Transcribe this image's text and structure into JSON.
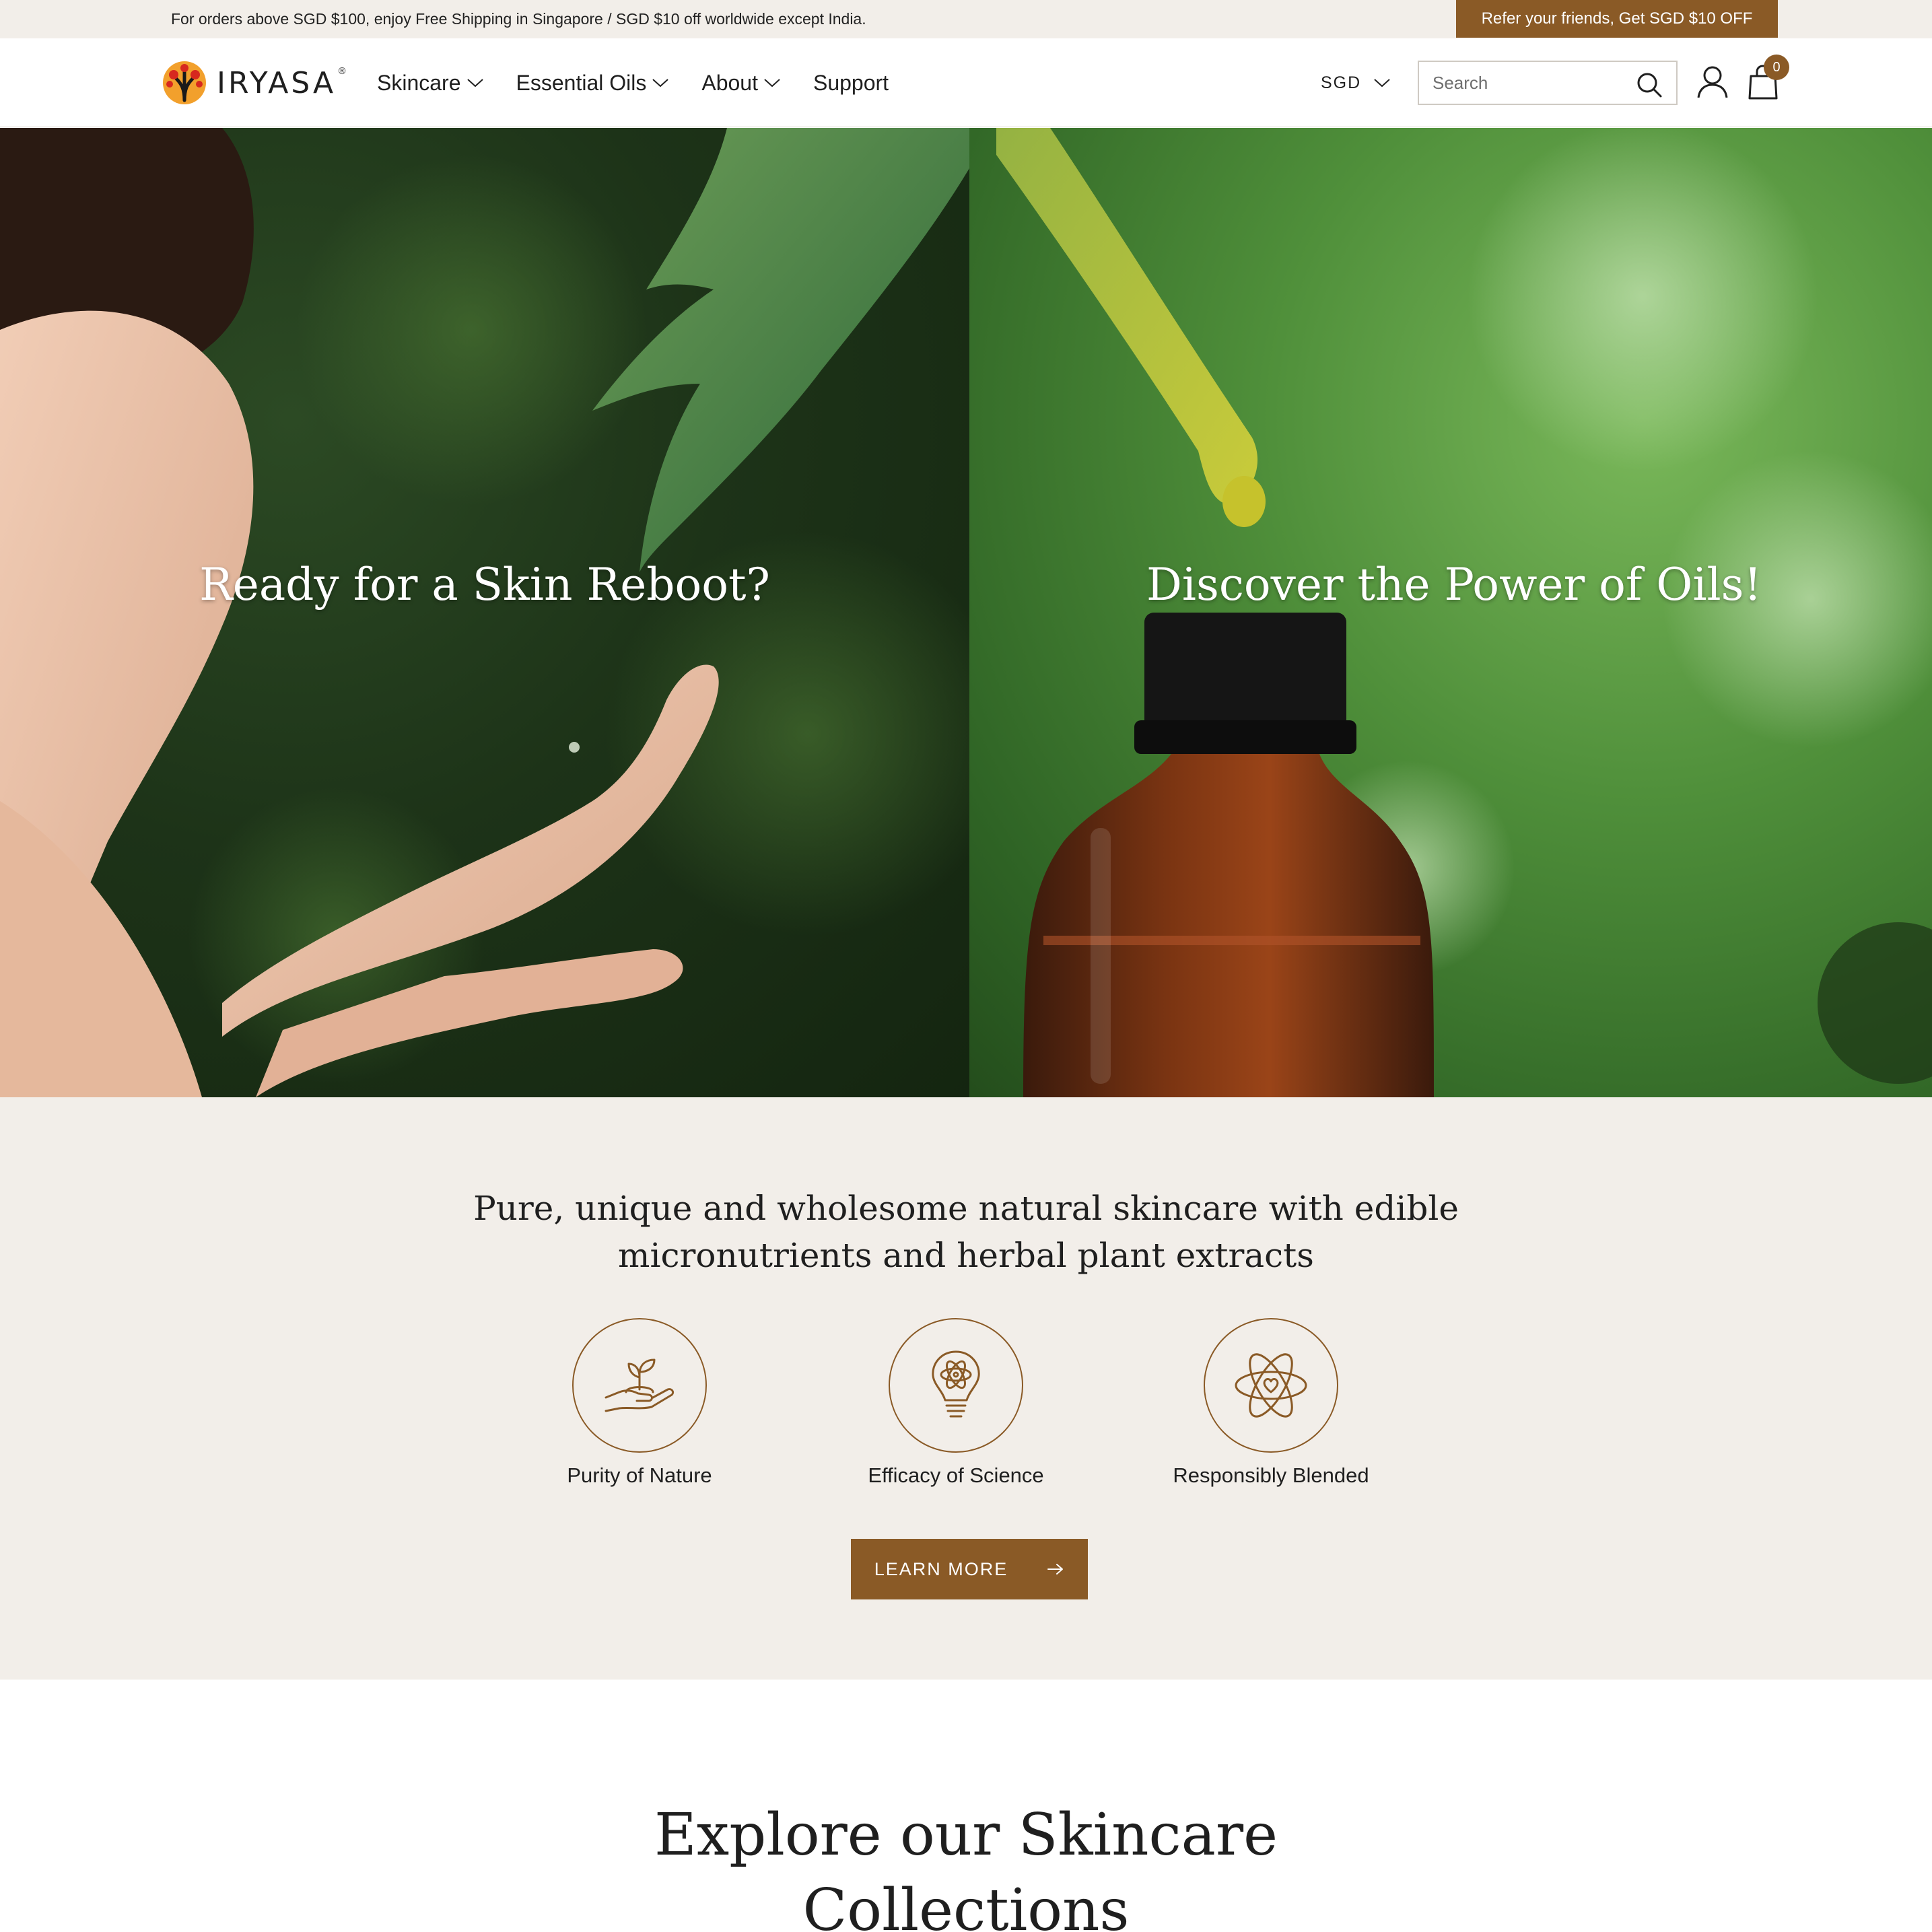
{
  "announcement": {
    "text": "For orders above SGD $100, enjoy Free Shipping in Singapore / SGD $10 off worldwide except India.",
    "refer_label": "Refer your friends, Get SGD $10 OFF"
  },
  "header": {
    "brand": "IRYASA",
    "brand_mark": "®",
    "nav": [
      {
        "label": "Skincare",
        "dropdown": true
      },
      {
        "label": "Essential Oils",
        "dropdown": true
      },
      {
        "label": "About",
        "dropdown": true
      },
      {
        "label": "Support",
        "dropdown": false
      }
    ],
    "currency": "SGD",
    "search_placeholder": "Search",
    "cart_count": "0"
  },
  "hero": {
    "left_heading": "Ready for a Skin Reboot?",
    "right_heading": "Discover the Power of Oils!"
  },
  "pillars": {
    "title": "Pure, unique and wholesome natural skincare with edible micronutrients and herbal plant extracts",
    "items": [
      {
        "label": "Purity of Nature",
        "icon": "hand-sprout-icon"
      },
      {
        "label": "Efficacy of Science",
        "icon": "lightbulb-atom-icon"
      },
      {
        "label": "Responsibly Blended",
        "icon": "atom-heart-icon"
      }
    ],
    "button_label": "LEARN MORE"
  },
  "collections": {
    "title": "Explore our Skincare Collections"
  },
  "colors": {
    "accent": "#8a5a26",
    "announcement_bg": "#f2eee9",
    "section_bg": "#f2eee9"
  }
}
